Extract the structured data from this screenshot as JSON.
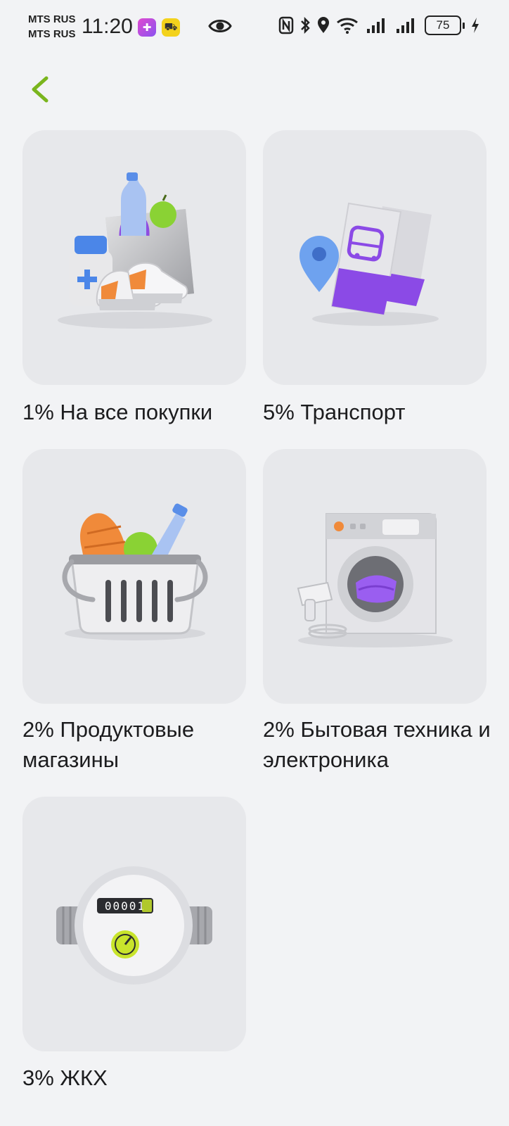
{
  "status_bar": {
    "carrier_1": "MTS RUS",
    "carrier_2": "MTS RUS",
    "time": "11:20",
    "battery": "75",
    "icons": [
      "app-badge-health-icon",
      "app-badge-delivery-icon",
      "eye-icon",
      "nfc-icon",
      "bluetooth-icon",
      "location-icon",
      "wifi-icon",
      "signal-icon",
      "signal-icon",
      "battery-icon",
      "charging-icon"
    ]
  },
  "header": {
    "back_icon": "chevron-left-icon",
    "accent_color": "#7ab51d"
  },
  "categories": [
    {
      "label": "1% На все покупки",
      "icon": "shopping-bag-icon"
    },
    {
      "label": "5% Транспорт",
      "icon": "transport-ticket-icon"
    },
    {
      "label": "2% Продуктовые магазины",
      "icon": "grocery-basket-icon"
    },
    {
      "label": "2% Бытовая техника и электроника",
      "icon": "washing-machine-icon"
    },
    {
      "label": "3% ЖКХ",
      "icon": "utility-meter-icon"
    }
  ],
  "meter_reading": "00001"
}
